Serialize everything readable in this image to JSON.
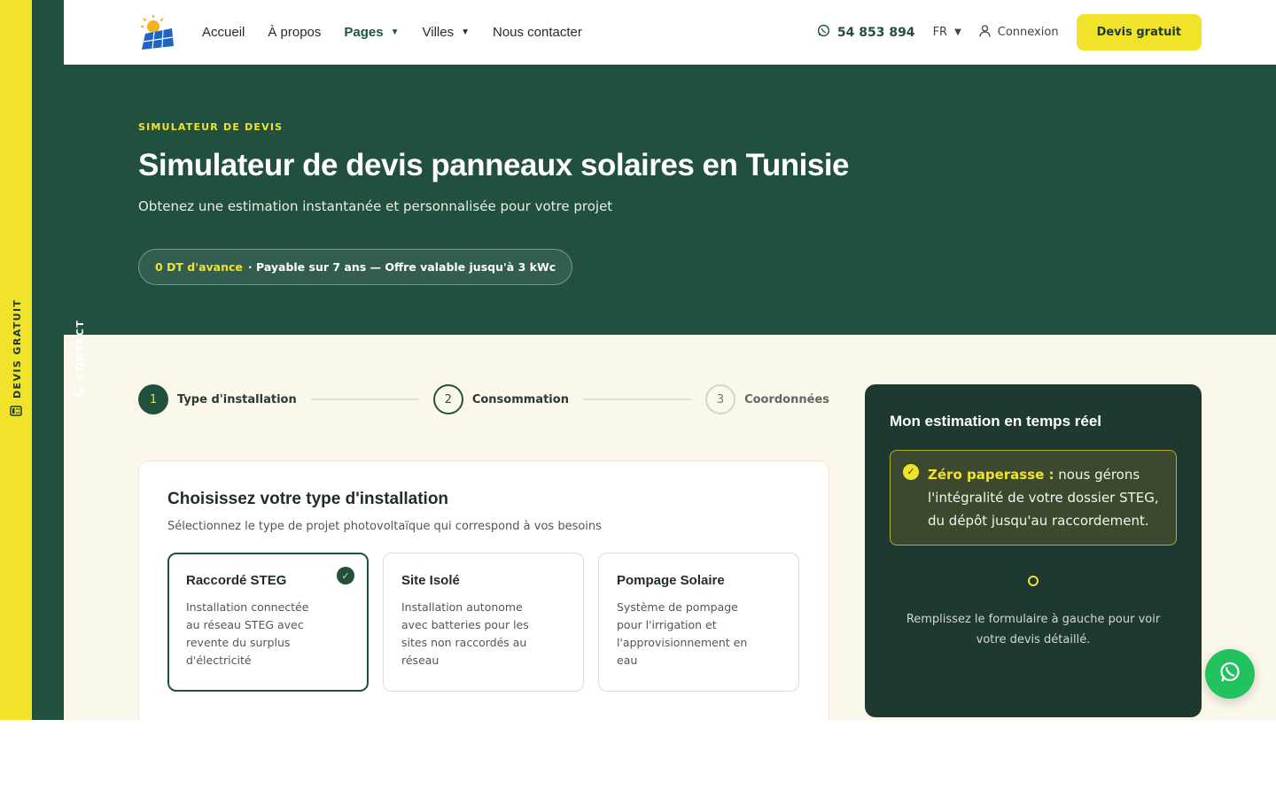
{
  "side_tabs": {
    "devis": "DEVIS GRATUIT",
    "contact": "CONTACT"
  },
  "header": {
    "nav": [
      {
        "label": "Accueil"
      },
      {
        "label": "À propos"
      },
      {
        "label": "Pages"
      },
      {
        "label": "Villes"
      },
      {
        "label": "Nous contacter"
      }
    ],
    "phone": "54 853 894",
    "lang": "FR",
    "login": "Connexion",
    "cta": "Devis gratuit"
  },
  "hero": {
    "eyebrow": "SIMULATEUR DE DEVIS",
    "title": "Simulateur de devis panneaux solaires en Tunisie",
    "subtitle": "Obtenez une estimation instantanée et personnalisée pour votre projet",
    "promo_accent": "0 DT d'avance",
    "promo_text": "· Payable sur 7 ans — Offre valable jusqu'à 3 kWc"
  },
  "stepper": [
    {
      "number": "1",
      "label": "Type d'installation"
    },
    {
      "number": "2",
      "label": "Consommation"
    },
    {
      "number": "3",
      "label": "Coordonnées"
    }
  ],
  "installation": {
    "title": "Choisissez votre type d'installation",
    "subtitle": "Sélectionnez le type de projet photovoltaïque qui correspond à vos besoins",
    "options": [
      {
        "title": "Raccordé STEG",
        "description": "Installation connectée au réseau STEG avec revente du surplus d'électricité"
      },
      {
        "title": "Site Isolé",
        "description": "Installation autonome avec batteries pour les sites non raccordés au réseau"
      },
      {
        "title": "Pompage Solaire",
        "description": "Système de pompage pour l'irrigation et l'approvisionnement en eau"
      }
    ]
  },
  "estimate_panel": {
    "title": "Mon estimation en temps réel",
    "note_strong": "Zéro paperasse :",
    "note_text": "nous gérons l'intégralité de votre dossier STEG, du dépôt jusqu'au raccordement.",
    "hint": "Remplissez le formulaire à gauche pour voir votre devis détaillé."
  },
  "colors": {
    "brand_green": "#22503f",
    "accent_yellow": "#f0e32a",
    "cream": "#fbf7ea",
    "whatsapp": "#22c25e"
  }
}
